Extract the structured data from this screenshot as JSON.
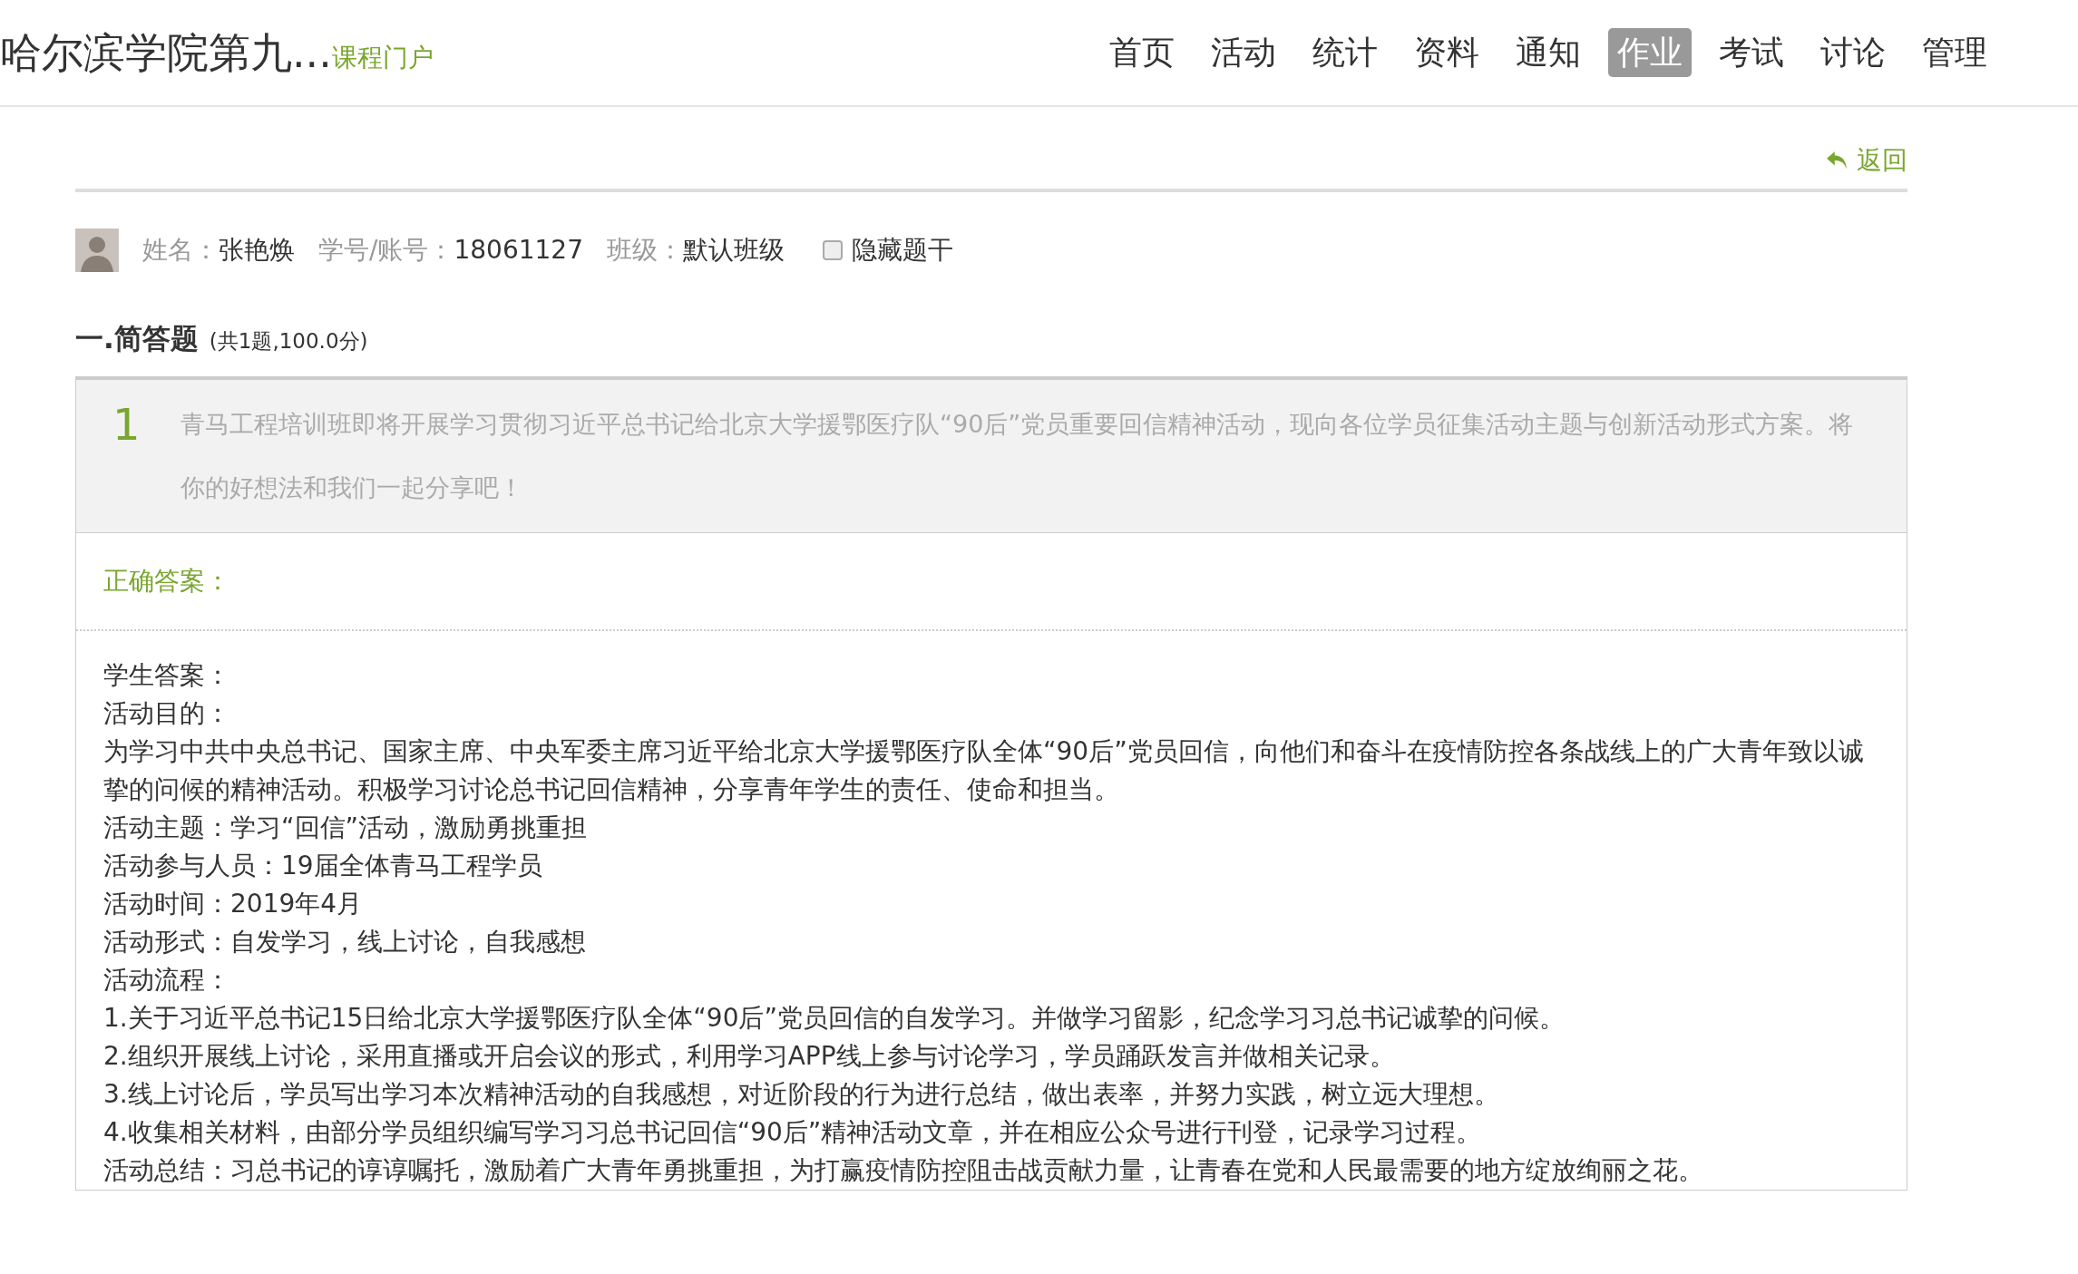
{
  "header": {
    "course_title": "哈尔滨学院第九...",
    "portal_link": "课程门户",
    "nav": [
      {
        "label": "首页",
        "selected": false
      },
      {
        "label": "活动",
        "selected": false
      },
      {
        "label": "统计",
        "selected": false
      },
      {
        "label": "资料",
        "selected": false
      },
      {
        "label": "通知",
        "selected": false
      },
      {
        "label": "作业",
        "selected": true
      },
      {
        "label": "考试",
        "selected": false
      },
      {
        "label": "讨论",
        "selected": false
      },
      {
        "label": "管理",
        "selected": false
      }
    ]
  },
  "back_link": "返回",
  "student": {
    "fields": [
      {
        "label": "姓名：",
        "value": "张艳焕"
      },
      {
        "label": "学号/账号：",
        "value": "18061127"
      },
      {
        "label": "班级：",
        "value": "默认班级"
      }
    ],
    "hide_stem": {
      "label": "隐藏题干",
      "checked": false
    }
  },
  "section": {
    "title": "一.简答题",
    "summary": "(共1题,100.0分)"
  },
  "question": {
    "number": "1",
    "text": "青马工程培训班即将开展学习贯彻习近平总书记给北京大学援鄂医疗队“90后”党员重要回信精神活动，现向各位学员征集活动主题与创新活动形式方案。将你的好想法和我们一起分享吧！",
    "correct_answer_label": "正确答案：",
    "student_answer_lines": [
      "学生答案：",
      "活动目的：",
      "为学习中共中央总书记、国家主席、中央军委主席习近平给北京大学援鄂医疗队全体“90后”党员回信，向他们和奋斗在疫情防控各条战线上的广大青年致以诚挚的问候的精神活动。积极学习讨论总书记回信精神，分享青年学生的责任、使命和担当。",
      "活动主题：学习“回信”活动，激励勇挑重担",
      "活动参与人员：19届全体青马工程学员",
      "活动时间：2019年4月",
      "活动形式：自发学习，线上讨论，自我感想",
      "活动流程：",
      "1.关于习近平总书记15日给北京大学援鄂医疗队全体“90后”党员回信的自发学习。并做学习留影，纪念学习习总书记诚挚的问候。",
      "2.组织开展线上讨论，采用直播或开启会议的形式，利用学习APP线上参与讨论学习，学员踊跃发言并做相关记录。",
      "3.线上讨论后，学员写出学习本次精神活动的自我感想，对近阶段的行为进行总结，做出表率，并努力实践，树立远大理想。",
      "4.收集相关材料，由部分学员组织编写学习习总书记回信“90后”精神活动文章，并在相应公众号进行刊登，记录学习过程。",
      "活动总结：习总书记的谆谆嘱托，激励着广大青年勇挑重担，为打赢疫情防控阻击战贡献力量，让青春在党和人民最需要的地方绽放绚丽之花。"
    ]
  }
}
